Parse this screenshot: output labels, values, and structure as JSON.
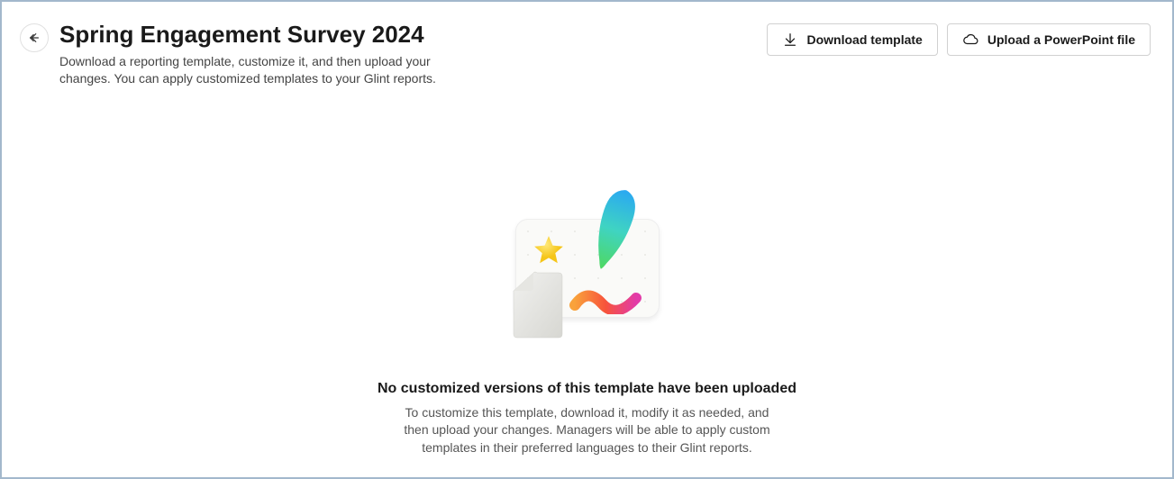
{
  "header": {
    "title": "Spring Engagement Survey 2024",
    "subtitle": "Download a reporting template, customize it, and then upload your changes. You can apply customized templates to your Glint reports.",
    "buttons": {
      "download": "Download template",
      "upload": "Upload a PowerPoint file"
    }
  },
  "emptyState": {
    "title": "No customized versions of this template have been uploaded",
    "description": "To customize this template, download it, modify it as needed, and then upload your changes. Managers will be able to apply custom templates in their preferred languages to their Glint reports."
  }
}
